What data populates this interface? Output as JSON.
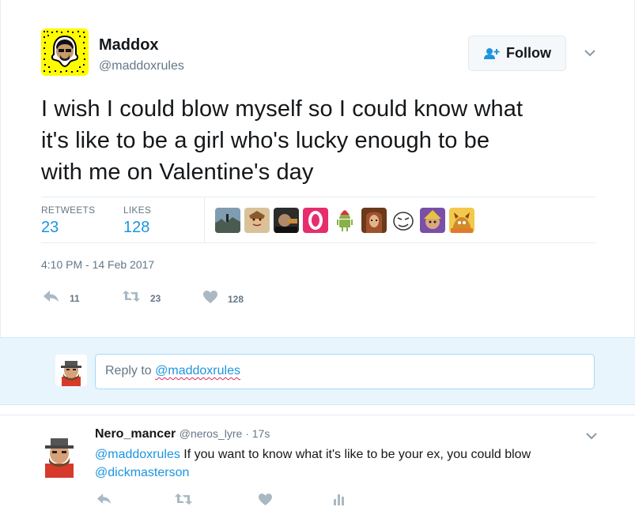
{
  "tweet": {
    "author_name": "Maddox",
    "author_handle": "@maddoxrules",
    "follow_label": "Follow",
    "text_lines": [
      "I wish I could blow myself so I could know what",
      "it's like to be a girl who's lucky enough to be",
      "with me on Valentine's day"
    ],
    "stats": {
      "retweets_label": "RETWEETS",
      "retweets_value": "23",
      "likes_label": "LIKES",
      "likes_value": "128"
    },
    "timestamp": "4:10 PM - 14 Feb 2017",
    "actions": {
      "reply_count": "11",
      "retweet_count": "23",
      "like_count": "128"
    }
  },
  "reply_composer": {
    "prefix": "Reply to ",
    "handle": "@maddoxrules"
  },
  "reply_tweet": {
    "name": "Nero_mancer",
    "handle": "@neros_lyre",
    "separator": " · ",
    "time": "17s",
    "mention1": "@maddoxrules",
    "text": " If you want to know what it's like to be your ex, you could blow",
    "mention2": "@dickmasterson"
  },
  "colors": {
    "accent": "#1b95e0",
    "muted": "#657786",
    "reply_bg": "#e8f5fd",
    "snap_yellow": "#fffc00"
  },
  "icons": [
    "follow-user-icon",
    "chevron-down-icon",
    "reply-icon",
    "retweet-icon",
    "heart-icon",
    "analytics-icon"
  ]
}
